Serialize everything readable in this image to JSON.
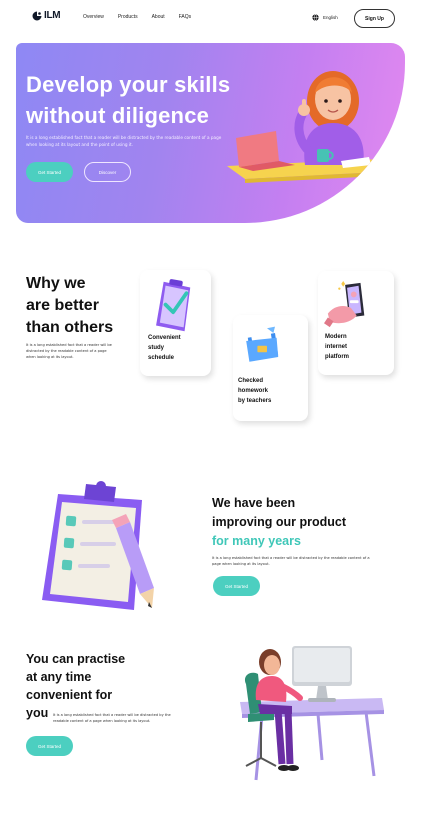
{
  "header": {
    "logo_text": "ILM",
    "nav": [
      "Overview",
      "Products",
      "About",
      "FAQs"
    ],
    "language": "English",
    "signup_label": "Sign Up"
  },
  "hero": {
    "title_line1": "Develop your skills",
    "title_line2": "without diligence",
    "description": "It is a long established fact that a reader will be distracted by the readable content of a page when looking at its layout and the point of using it.",
    "primary_button": "Get Started",
    "secondary_button": "Discover"
  },
  "why": {
    "title_line1": "Why we",
    "title_line2": "are better",
    "title_line3": "than others",
    "description": "It is a long established fact that a reader will be distracted by the readable content of a page when looking at its layout.",
    "cards": [
      {
        "line1": "Convenient",
        "line2": "study",
        "line3": "schedule"
      },
      {
        "line1": "Checked",
        "line2": "homework",
        "line3": "by teachers"
      },
      {
        "line1": "Modern",
        "line2": "internet",
        "line3": "platform"
      }
    ]
  },
  "improving": {
    "title_line1": "We have been",
    "title_line2": "improving our product",
    "title_accent": "for many years",
    "description": "It is a long established fact that a reader will be distracted by the readable content of a page when looking at its layout.",
    "button": "Get Started"
  },
  "practise": {
    "title_line1": "You can practise",
    "title_line2": "at any time",
    "title_line3": "convenient for",
    "title_line4": "you",
    "description": "It is a long established fact that a reader will be distracted by the readable content of a page when looking at its layout.",
    "button": "Get Started"
  },
  "colors": {
    "accent_teal": "#4ccfc0",
    "hero_gradient_start": "#8e88f4",
    "hero_gradient_end": "#e389f0"
  },
  "icons": {
    "logo": "ilm-logo-icon",
    "globe": "globe-icon",
    "card1": "checklist-clipboard-icon",
    "card2": "homework-folder-icon",
    "card3": "phone-hand-icon"
  }
}
